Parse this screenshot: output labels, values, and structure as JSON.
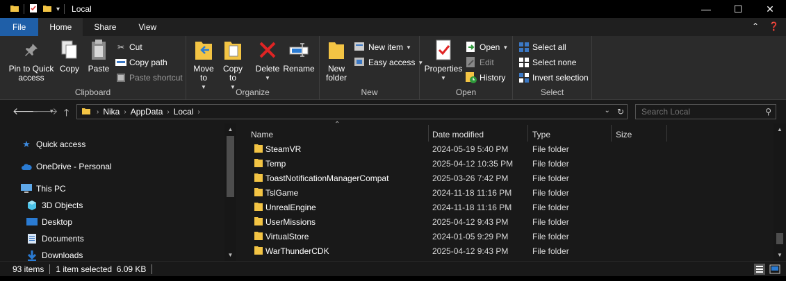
{
  "titlebar": {
    "title": "Local",
    "minimize_icon": "minimize-icon",
    "maximize_icon": "maximize-icon",
    "close_icon": "close-icon"
  },
  "tabs": {
    "file": "File",
    "home": "Home",
    "share": "Share",
    "view": "View"
  },
  "ribbon": {
    "clipboard": {
      "label": "Clipboard",
      "pin": "Pin to Quick access",
      "copy": "Copy",
      "paste": "Paste",
      "cut": "Cut",
      "copy_path": "Copy path",
      "paste_shortcut": "Paste shortcut"
    },
    "organize": {
      "label": "Organize",
      "move_to": "Move to",
      "copy_to": "Copy to",
      "delete": "Delete",
      "rename": "Rename"
    },
    "new": {
      "label": "New",
      "new_folder": "New folder",
      "new_item": "New item",
      "easy_access": "Easy access"
    },
    "open": {
      "label": "Open",
      "properties": "Properties",
      "open": "Open",
      "edit": "Edit",
      "history": "History"
    },
    "select": {
      "label": "Select",
      "select_all": "Select all",
      "select_none": "Select none",
      "invert_selection": "Invert selection"
    }
  },
  "address": {
    "breadcrumb": [
      "Nika",
      "AppData",
      "Local"
    ],
    "search_placeholder": "Search Local"
  },
  "navpane": {
    "items": [
      {
        "label": "Quick access",
        "icon": "star-icon"
      },
      {
        "label": "OneDrive - Personal",
        "icon": "cloud-icon"
      },
      {
        "label": "This PC",
        "icon": "computer-icon"
      },
      {
        "label": "3D Objects",
        "icon": "cube-icon"
      },
      {
        "label": "Desktop",
        "icon": "desktop-icon"
      },
      {
        "label": "Documents",
        "icon": "documents-icon"
      },
      {
        "label": "Downloads",
        "icon": "download-icon"
      }
    ]
  },
  "filelist": {
    "columns": {
      "name": "Name",
      "date": "Date modified",
      "type": "Type",
      "size": "Size"
    },
    "rows": [
      {
        "name": "SteamVR",
        "date": "2024-05-19 5:40 PM",
        "type": "File folder"
      },
      {
        "name": "Temp",
        "date": "2025-04-12 10:35 PM",
        "type": "File folder"
      },
      {
        "name": "ToastNotificationManagerCompat",
        "date": "2025-03-26 7:42 PM",
        "type": "File folder"
      },
      {
        "name": "TslGame",
        "date": "2024-11-18 11:16 PM",
        "type": "File folder"
      },
      {
        "name": "UnrealEngine",
        "date": "2024-11-18 11:16 PM",
        "type": "File folder"
      },
      {
        "name": "UserMissions",
        "date": "2025-04-12 9:43 PM",
        "type": "File folder"
      },
      {
        "name": "VirtualStore",
        "date": "2024-01-05 9:29 PM",
        "type": "File folder"
      },
      {
        "name": "WarThunderCDK",
        "date": "2025-04-12 9:43 PM",
        "type": "File folder"
      }
    ]
  },
  "statusbar": {
    "item_count": "93 items",
    "selection": "1 item selected  6.09 KB"
  },
  "colors": {
    "accent": "#1f5fa8",
    "folder": "#f3c444",
    "background": "#191919"
  }
}
